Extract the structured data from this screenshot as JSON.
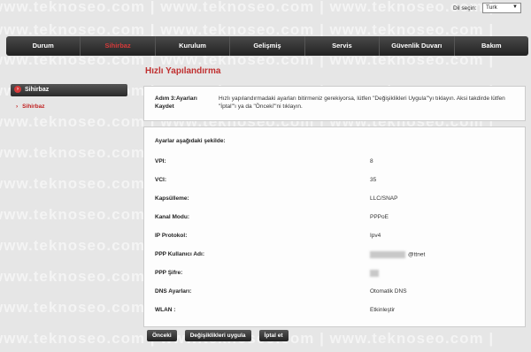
{
  "watermark_text": "www.teknoseo.com | www.teknoseo.com | www.teknoseo.com |",
  "language": {
    "label": "Dil seçin:",
    "selected": "Turk"
  },
  "nav": {
    "items": [
      "Durum",
      "Sihirbaz",
      "Kurulum",
      "Gelişmiş",
      "Servis",
      "Güvenlik Duvarı",
      "Bakım"
    ],
    "active_index": 1
  },
  "sidebar": {
    "section": "Sihirbaz",
    "item": "Sihirbaz"
  },
  "page_title": "Hızlı Yapılandırma",
  "step": {
    "label": "Adım 3:Ayarları Kaydet",
    "text": "Hızlı yapılandırmadaki ayarları bitirmeniz gerekiyorsa, lütfen \"Değişiklikleri Uygula\"'yı tıklayın. Aksi takdirde lütfen \"İptal\"'ı ya da \"Önceki\"'ni tıklayın."
  },
  "settings": {
    "heading": "Ayarlar aşağıdaki şekilde:",
    "rows": [
      {
        "label": "VPI:",
        "value": "8"
      },
      {
        "label": "VCI:",
        "value": "35"
      },
      {
        "label": "Kapsülleme:",
        "value": "LLC/SNAP"
      },
      {
        "label": "Kanal Modu:",
        "value": "PPPoE"
      },
      {
        "label": "IP Protokol:",
        "value": "Ipv4"
      },
      {
        "label": "PPP Kullanıcı Adı:",
        "value": "@ttnet"
      },
      {
        "label": "PPP Şifre:",
        "value": ""
      },
      {
        "label": "DNS Ayarları:",
        "value": "Otomatik DNS"
      },
      {
        "label": "WLAN :",
        "value": "Etkinleştir"
      }
    ]
  },
  "buttons": {
    "previous": "Önceki",
    "apply": "Değişiklikleri uygula",
    "cancel": "İptal et"
  },
  "colors": {
    "accent": "#c03030",
    "nav_bg": "#2a2a2a"
  }
}
